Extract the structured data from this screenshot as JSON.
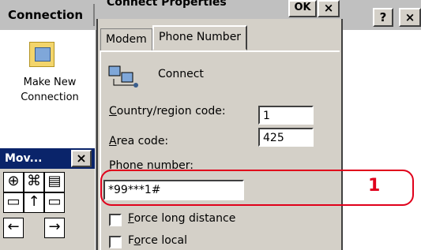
{
  "background_window": {
    "title": "Connection",
    "help_label": "?",
    "close_label": "×",
    "icon_label": "Make New Connection"
  },
  "input_panel": {
    "title": "Mov...",
    "close_label": "×"
  },
  "dialog": {
    "title": "Connect Properties",
    "ok_label": "OK",
    "close_label": "×",
    "tabs": [
      {
        "label": "Modem",
        "active": false
      },
      {
        "label": "Phone Number",
        "active": true
      }
    ],
    "connection_name": "Connect",
    "country_label_mnemonic": "C",
    "country_label_rest": "ountry/region code:",
    "country_value": "1",
    "area_label_mnemonic": "A",
    "area_label_rest": "rea code:",
    "area_value": "425",
    "phone_label_mnemonic": "P",
    "phone_label_rest": "hone number:",
    "phone_value": "*99***1#",
    "force_long_distance_mnemonic": "F",
    "force_long_distance_rest": "orce long distance",
    "force_local_prefix": "F",
    "force_local_mnemonic": "o",
    "force_local_rest": "rce local"
  },
  "callout": {
    "number": "1",
    "color": "#e0001b"
  }
}
